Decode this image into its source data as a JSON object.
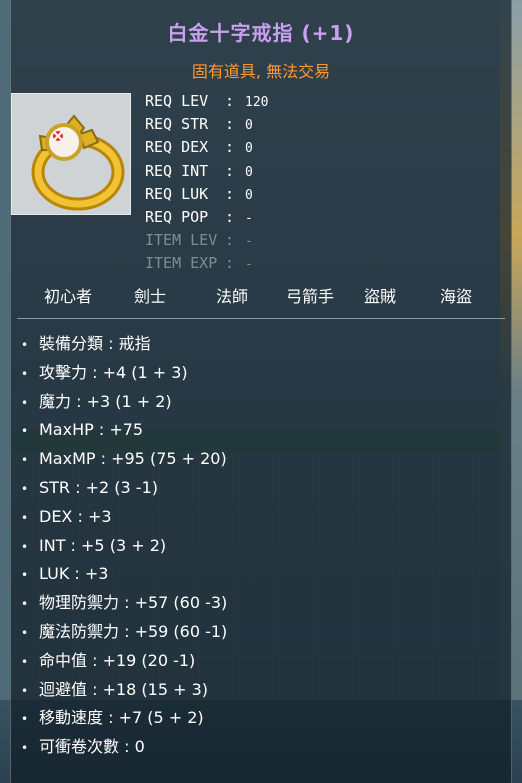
{
  "item": {
    "name": "白金十字戒指 (+1)",
    "tags": "固有道具, 無法交易",
    "icon": "gold-ring-red-gem-icon"
  },
  "requirements": [
    {
      "label": "REQ LEV",
      "value": "120",
      "dim": false
    },
    {
      "label": "REQ STR",
      "value": "0",
      "dim": false
    },
    {
      "label": "REQ DEX",
      "value": "0",
      "dim": false
    },
    {
      "label": "REQ INT",
      "value": "0",
      "dim": false
    },
    {
      "label": "REQ LUK",
      "value": "0",
      "dim": false
    },
    {
      "label": "REQ POP",
      "value": "-",
      "dim": false
    },
    {
      "label": "ITEM LEV",
      "value": "-",
      "dim": true
    },
    {
      "label": "ITEM EXP",
      "value": "-",
      "dim": true
    }
  ],
  "separator": ":",
  "jobs": [
    "初心者",
    "劍士",
    "法師",
    "弓箭手",
    "盜賊",
    "海盜"
  ],
  "bullet": "•",
  "stats": [
    "裝備分類 : 戒指",
    "攻擊力 : +4 (1 + 3)",
    "魔力 : +3 (1 + 2)",
    "MaxHP : +75",
    "MaxMP : +95 (75 + 20)",
    "STR : +2 (3 -1)",
    "DEX : +3",
    "INT : +5 (3 + 2)",
    "LUK : +3",
    "物理防禦力 : +57 (60 -3)",
    "魔法防禦力 : +59 (60 -1)",
    "命中值 : +19 (20 -1)",
    "迴避值 : +18 (15 + 3)",
    "移動速度 : +7 (5 + 2)",
    "可衝卷次數 : 0"
  ],
  "colors": {
    "title": "#c8a0ef",
    "subtitle": "#ff9a2e",
    "text": "#ffffff",
    "dim": "#7f8d95"
  }
}
